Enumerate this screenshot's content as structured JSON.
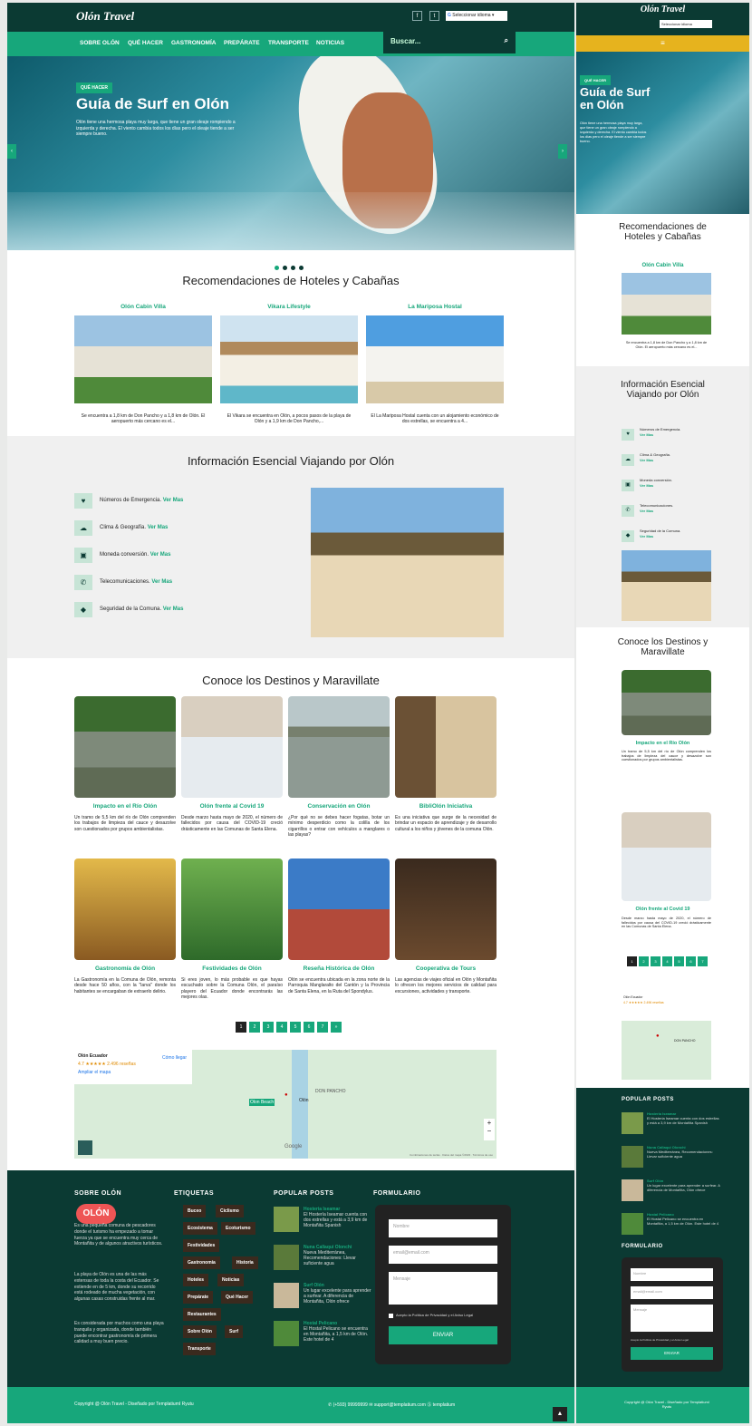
{
  "brand": "Olón Travel",
  "lang": "Seleccionar idioma",
  "nav": [
    "SOBRE OLÓN",
    "QUÉ HACER",
    "GASTRONOMÍA",
    "PREPÁRATE",
    "TRANSPORTE",
    "NOTICIAS"
  ],
  "search": "Buscar...",
  "hero": {
    "badge": "QUÉ HACER",
    "title": "Guía de Surf en Olón",
    "text": "Olón tiene una hermosa playa muy larga, que tiene un gran oleaje rompiendo a izquierda y derecha. El viento cambia todos los días pero el oleaje tiende a ser siempre bueno."
  },
  "hotels": {
    "title": "Recomendaciones de Hoteles y Cabañas",
    "items": [
      {
        "name": "Olón Cabin Villa",
        "text": "Se encuentra a 1,8 km de Don Pancho y a 1,8 km de Olón. El aeropuerto más cercano es el..."
      },
      {
        "name": "Vikara Lifestyle",
        "text": "El Vikara se encuentra en Olón, a pocos pasos de la playa de Olón y a 1,9 km de Don Pancho,..."
      },
      {
        "name": "La Mariposa Hostal",
        "text": "El La Mariposa Hostal cuenta con un alojamiento económico de dos estrellas, se encuentra a 4..."
      }
    ]
  },
  "info": {
    "title": "Información Esencial Viajando por Olón",
    "more": "Ver Mas",
    "items": [
      {
        "label": "Números de Emergencia.",
        "icon": "heart-icon",
        "g": "♥"
      },
      {
        "label": "Clima & Geografía.",
        "icon": "cloud-icon",
        "g": "☁"
      },
      {
        "label": "Moneda conversión.",
        "icon": "money-icon",
        "g": "▣"
      },
      {
        "label": "Telecomunicaciones.",
        "icon": "phone-icon",
        "g": "✆"
      },
      {
        "label": "Seguridad de la Comuna.",
        "icon": "shield-icon",
        "g": "◆"
      }
    ]
  },
  "dest": {
    "title": "Conoce los Destinos y Maravillate",
    "items": [
      {
        "name": "Impacto en el Río Olón",
        "text": "Un tramo de 5,5 km del río de Olón comprenden los trabajos de limpieza del cauce y desazolve son cuestionados por grupos ambientalistas."
      },
      {
        "name": "Olón frente al Covid 19",
        "text": "Desde marzo hasta mayo de 2020, el número de fallecidos por causa del COVID-19 creció drásticamente en las Comunas de Santa Elena."
      },
      {
        "name": "Conservación en Olón",
        "text": "¿Por qué no se debes hacer fogatas, botar un mínimo desperdicio como la colilla de los cigarrillos o entrar con vehículos a manglares o las playas?"
      },
      {
        "name": "BibliOlón Iniciativa",
        "text": "Es una iniciativa que surge de la necesidad de brindar un espacio de aprendizaje y de desarrollo cultural a los niños y jóvenes de la comuna Olón."
      },
      {
        "name": "Gastronomía de Olón",
        "text": "La Gastronomía en la Comuna de Olón, remonta desde hace 50 años, con la \"larva\" donde los habitantes se encargaban de extraerlo delirio."
      },
      {
        "name": "Festividades de Olón",
        "text": "Si eres joven, lo más probable es que hayas escuchado sobre la Comuna Olón, el paraíso playero del Ecuador donde encontrarás las mejores olas."
      },
      {
        "name": "Reseña Histórica de Olón",
        "text": "Olón se encuentra ubicada en la zona norte de la Parroquia Manglaralto del Cantón y la Provincia de Santa Elena, en la Ruta del Spondylus."
      },
      {
        "name": "Cooperativa de Tours",
        "text": "Las agencias de viajes oficial en Olón y Montañita lo ofrecen los mejores servicios de calidad para excursiones, actividades y transporte."
      }
    ],
    "pages": [
      "1",
      "2",
      "3",
      "4",
      "5",
      "6",
      "7",
      "»"
    ]
  },
  "map": {
    "place": "Olón Ecuador",
    "rating": "4.7 ★★★★★ 2.496 reseñas",
    "bigger": "Ampliar el mapa",
    "dir": "Cómo llegar",
    "pin": "Olón",
    "area": "DON PANCHO",
    "beach": "Olon Beach",
    "foot": "Combinaciones de teclas · Datos del mapa ©2023 · Términos de uso",
    "zin": "+",
    "zout": "−",
    "g": "Google"
  },
  "footer": {
    "about_h": "SOBRE OLÓN",
    "about": [
      "Es una pequeña comuna de pescadores donde el turismo ha empezado a tomar fuerza ya que se encuentra muy cerca de Montañita y de algunos atractivos turísticos.",
      "La playa de Olón es una de las más extensas de toda la costa del Ecuador. Se extiende en de 5 km, donde su recorrido está rodeado de mucha vegetación, con algunas casas construidas frente al mar.",
      "Es considerada por muchos como una playa tranquila y organizada, donde también puede encontrar gastronomía de primera calidad a muy buen precio."
    ],
    "tags_h": "ETIQUETAS",
    "tags": [
      "Buceo",
      "Ciclismo",
      "Ecosistema",
      "Ecoturismo",
      "Festividades",
      "Gastronomía",
      "Historia",
      "Hoteles",
      "Noticias",
      "Prepárate",
      "Qué Hacer",
      "Restaurantes",
      "Sobre Olón",
      "Surf",
      "Transporte"
    ],
    "posts_h": "POPULAR POSTS",
    "posts": [
      {
        "t": "Hosteria Iseamar",
        "x": "El Hostería Iseamar cuenta con dos estrellas y está a 3,9 km de Montañita Spanish"
      },
      {
        "t": "Nuna Callaqui Olonchi",
        "x": "Nueva Mediterránea, Recomendaciones: Llevar suficiente agua"
      },
      {
        "t": "Surf Olón",
        "x": "Un lugar excelente para aprender a surfear. A diferencia de Montañita, Olón ofrece"
      },
      {
        "t": "Hostal Pelicano",
        "x": "El Hostal Pelicano se encuentra en Montañita, a 1,5 km de Olón. Este hotel de 4"
      }
    ],
    "form_h": "FORMULARIO",
    "form": {
      "name": "Nombre",
      "email": "email@email.com",
      "msg": "Mensaje",
      "agree": "Acepto la Política de Privacidad y el Aviso Legal",
      "send": "ENVIAR"
    },
    "copy": "Copyright @ Olón Travel - Diseñado por TemplatiumI Ryutu",
    "phone": "(+593) 99999999",
    "mail": "support@templatium.com",
    "skype": "templatium",
    "top": "▲"
  },
  "colors": {
    "green": "#17a77b",
    "dark": "#0b3a33",
    "yellow": "#e6b31e"
  }
}
